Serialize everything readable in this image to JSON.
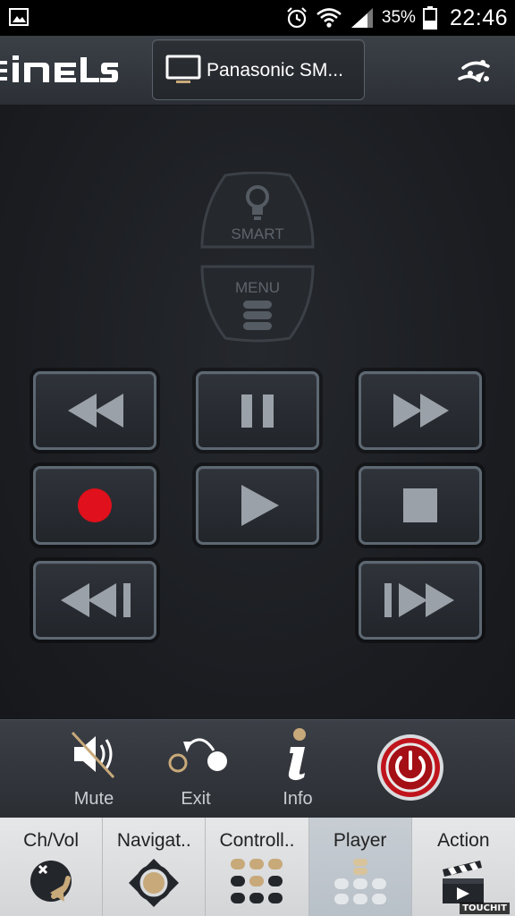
{
  "status_bar": {
    "battery_percent": "35%",
    "time": "22:46",
    "icons": [
      "gallery-icon",
      "alarm-icon",
      "wifi-icon",
      "signal-icon",
      "battery-icon"
    ]
  },
  "header": {
    "logo_text": "iNELS",
    "device_name": "Panasonic SM...",
    "icons": [
      "tv-icon",
      "settings-icon"
    ]
  },
  "remote": {
    "smart_label": "SMART",
    "menu_label": "MENU",
    "media_buttons": [
      "rewind",
      "pause",
      "fast-forward",
      "record",
      "play",
      "stop",
      "skip-back",
      "skip-forward"
    ],
    "colors": {
      "record": "#e0101c",
      "glyph": "#9aa1a8",
      "border": "#5d6872"
    }
  },
  "actions": {
    "mute_label": "Mute",
    "exit_label": "Exit",
    "info_label": "Info",
    "power_color": "#c0141c"
  },
  "tabs": [
    {
      "label": "Ch/Vol",
      "icon": "ch-vol-icon",
      "active": false
    },
    {
      "label": "Navigat..",
      "icon": "navigation-icon",
      "active": false
    },
    {
      "label": "Controll..",
      "icon": "controller-icon",
      "active": false
    },
    {
      "label": "Player",
      "icon": "player-icon",
      "active": true
    },
    {
      "label": "Action",
      "icon": "clapperboard-icon",
      "active": false
    }
  ],
  "watermark": "TOUCHIT"
}
